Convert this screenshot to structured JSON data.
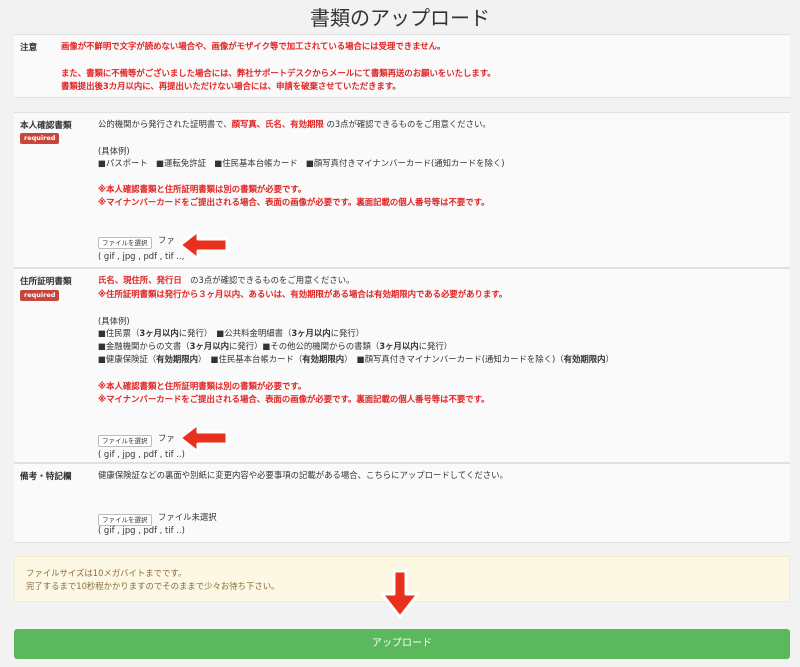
{
  "page_title": "書類のアップロード",
  "notice": {
    "label": "注意",
    "line1": "画像が不鮮明で文字が読めない場合や、画像がモザイク等で加工されている場合には受理できません。",
    "line2": "また、書類に不備等がございました場合には、弊社サポートデスクからメールにて書類再送のお願いをいたします。",
    "line3": "書類提出後3カ月以内に、再提出いただけない場合には、申請を破棄させていただきます。"
  },
  "identity": {
    "label": "本人確認書類",
    "badge": "required",
    "intro_a": "公的機関から発行された証明書で、",
    "intro_red": "顔写真、氏名、有効期限",
    "intro_b": " の3点が確認できるものをご用意ください。",
    "examples_title": "(具体例)",
    "examples": "■パスポート　■運転免許証　■住民基本台帳カード　■顔写真付きマイナンバーカード(通知カードを除く)",
    "warn1": "※本人確認書類と住所証明書類は別の書類が必要です。",
    "warn2": "※マイナンバーカードをご提出される場合、表面の画像が必要です。裏面記載の個人番号等は不要です。",
    "file_button": "ファイルを選択",
    "file_status": "ファ",
    "formats": "( gif , jpg , pdf , tif ..,"
  },
  "address": {
    "label": "住所証明書類",
    "badge": "required",
    "intro_red": "氏名、現住所、発行日",
    "intro_b": "　の3点が確認できるものをご用意ください。",
    "warn_period": "※住所証明書類は発行から３ヶ月以内、あるいは、有効期限がある場合は有効期限内である必要があります。",
    "examples_title": "(具体例)",
    "ex1_a": "■住民票（",
    "ex1_b": "3ヶ月以内",
    "ex1_c": "に発行）　■公共料金明細書（",
    "ex1_d": "3ヶ月以内",
    "ex1_e": "に発行）",
    "ex2_a": "■金融機関からの文書（",
    "ex2_b": "3ヶ月以内",
    "ex2_c": "に発行）■その他公的機関からの書類（",
    "ex2_d": "3ヶ月以内",
    "ex2_e": "に発行）",
    "ex3_a": "■健康保険証（",
    "ex3_b": "有効期限内",
    "ex3_c": "）　■住民基本台帳カード（",
    "ex3_d": "有効期限内",
    "ex3_e": "）　■顔写真付きマイナンバーカード(通知カードを除く)（",
    "ex3_f": "有効期限内",
    "ex3_g": "）",
    "warn1": "※本人確認書類と住所証明書類は別の書類が必要です。",
    "warn2": "※マイナンバーカードをご提出される場合、表面の画像が必要です。裏面記載の個人番号等は不要です。",
    "file_button": "ファイルを選択",
    "file_status": "ファ",
    "formats": "( gif , jpg , pdf , tif ..)"
  },
  "remarks": {
    "label": "備考・特記欄",
    "intro": "健康保険証などの裏面や別紙に変更内容や必要事項の記載がある場合、こちらにアップロードしてください。",
    "file_button": "ファイルを選択",
    "file_status": "ファイル未選択",
    "formats": "( gif , jpg , pdf , tif ..)"
  },
  "info": {
    "line1": "ファイルサイズは10メガバイトまでです。",
    "line2": "完了するまで10秒程かかりますのでそのままで少々お待ち下さい。"
  },
  "upload_label": "アップロード",
  "colors": {
    "warning_red": "#e02424",
    "badge_red": "#c7463c",
    "arrow_red": "#e8301c",
    "upload_green": "#5cb85c",
    "notice_bg": "#fcf8e3"
  }
}
